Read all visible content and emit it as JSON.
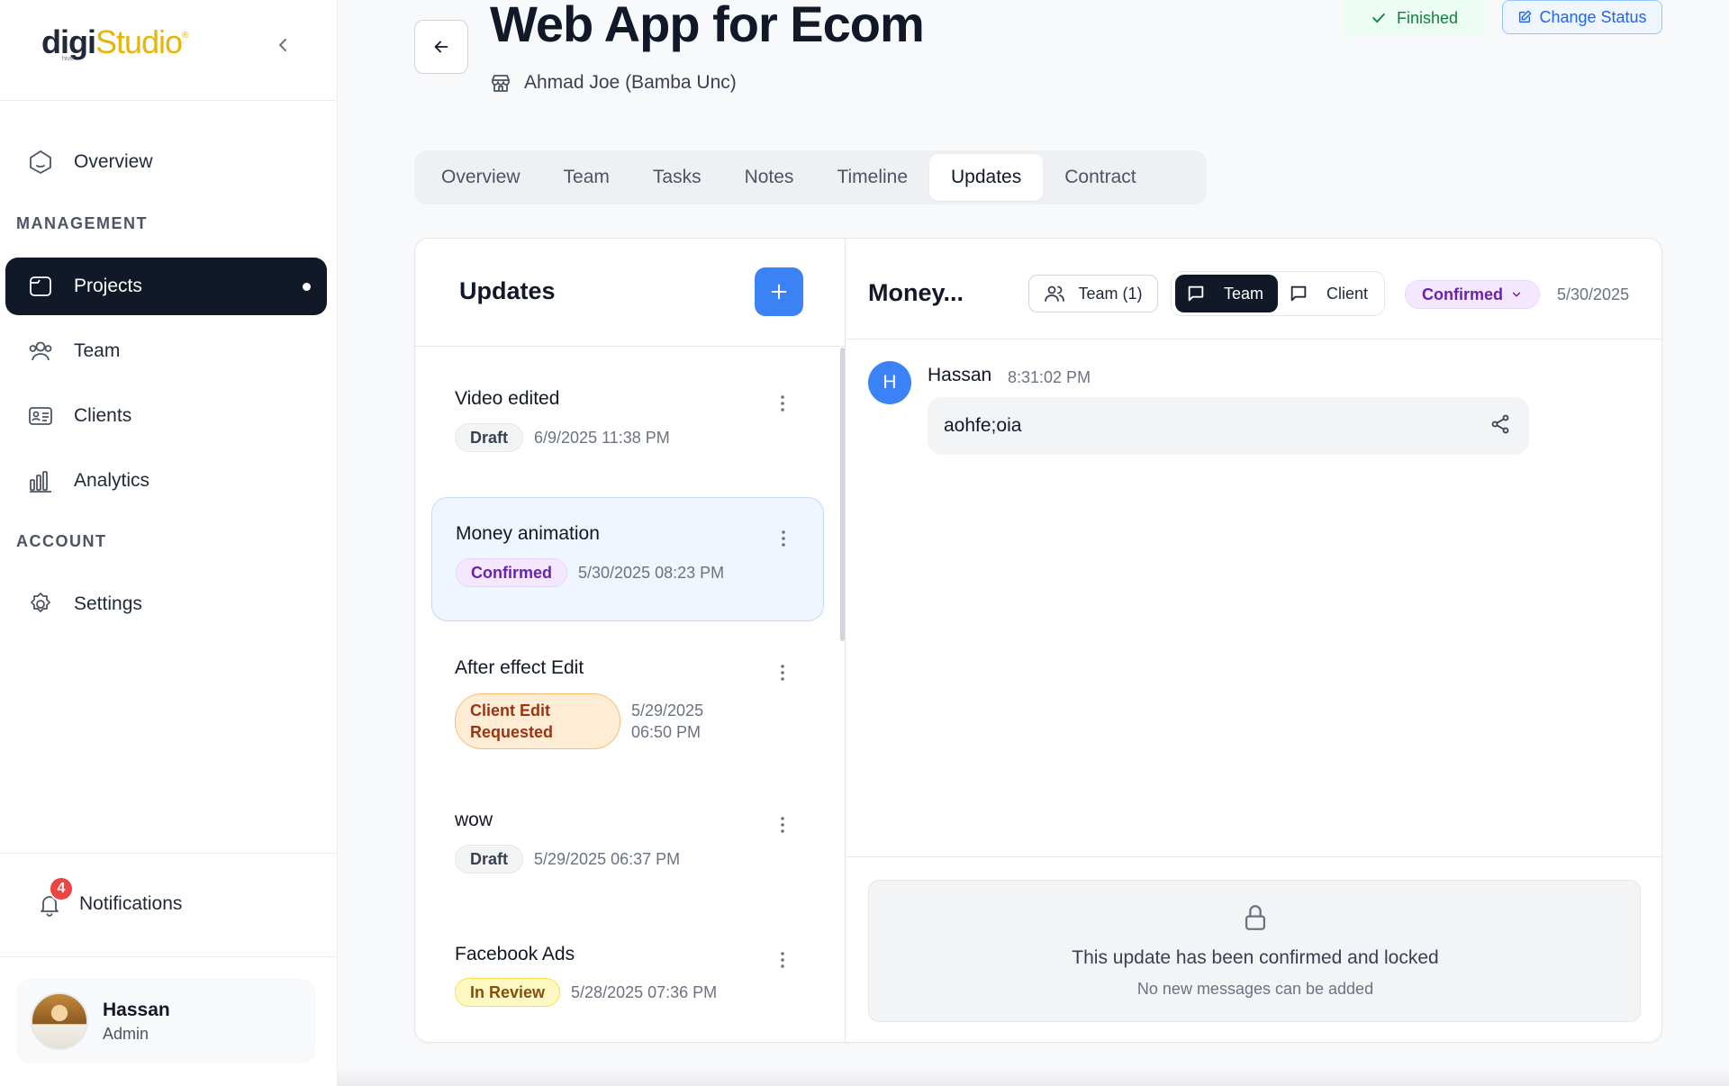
{
  "brand": {
    "logo_main": "digi",
    "logo_accent": "Studio",
    "logo_mark": "®",
    "logo_sub": "hive"
  },
  "sidebar": {
    "items": [
      {
        "label": "Overview",
        "icon": "home-icon"
      },
      {
        "label": "Projects",
        "icon": "folder-icon",
        "active": true
      },
      {
        "label": "Team",
        "icon": "users-icon"
      },
      {
        "label": "Clients",
        "icon": "contact-card-icon"
      },
      {
        "label": "Analytics",
        "icon": "bar-chart-icon"
      },
      {
        "label": "Settings",
        "icon": "gear-icon"
      }
    ],
    "sections": {
      "management": "MANAGEMENT",
      "account": "ACCOUNT"
    },
    "notifications": {
      "label": "Notifications",
      "count": "4"
    },
    "user": {
      "name": "Hassan",
      "role": "Admin"
    }
  },
  "header": {
    "title": "Web App for Ecom",
    "client": "Ahmad Joe (Bamba Unc)",
    "status": "Finished",
    "change_status": "Change Status"
  },
  "tabs": [
    {
      "label": "Overview"
    },
    {
      "label": "Team"
    },
    {
      "label": "Tasks"
    },
    {
      "label": "Notes"
    },
    {
      "label": "Timeline"
    },
    {
      "label": "Updates",
      "active": true
    },
    {
      "label": "Contract"
    }
  ],
  "updates": {
    "title": "Updates",
    "items": [
      {
        "name": "Video edited",
        "status": "Draft",
        "date": "6/9/2025 11:38 PM"
      },
      {
        "name": "Money animation",
        "status": "Confirmed",
        "date": "5/30/2025 08:23 PM"
      },
      {
        "name": "After effect Edit",
        "status": "Client Edit Requested",
        "date": "5/29/2025 06:50 PM"
      },
      {
        "name": "wow",
        "status": "Draft",
        "date": "5/29/2025 06:37 PM"
      },
      {
        "name": "Facebook Ads",
        "status": "In Review",
        "date": "5/28/2025 07:36 PM"
      }
    ]
  },
  "detail": {
    "title": "Money...",
    "team_count": "Team (1)",
    "toggle": {
      "team": "Team",
      "client": "Client"
    },
    "status": "Confirmed",
    "date": "5/30/2025",
    "message": {
      "initial": "H",
      "author": "Hassan",
      "time": "8:31:02 PM",
      "text": "aohfe;oia"
    },
    "locked": {
      "title": "This update has been confirmed and locked",
      "subtitle": "No new messages can be added"
    }
  },
  "colors": {
    "accent": "#3b82f6",
    "sidebar_active": "#111827",
    "confirmed": "#6b21a8",
    "finished": "#15803d",
    "edit_requested": "#9a3412",
    "in_review": "#854d0e"
  }
}
